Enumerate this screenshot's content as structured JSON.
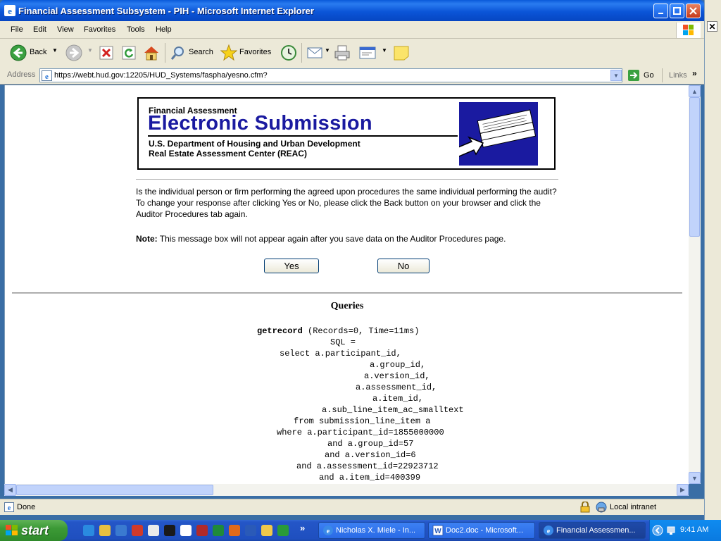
{
  "window": {
    "title": "Financial Assessment Subsystem - PIH - Microsoft Internet Explorer"
  },
  "menu": [
    "File",
    "Edit",
    "View",
    "Favorites",
    "Tools",
    "Help"
  ],
  "toolbar": {
    "back": "Back",
    "search": "Search",
    "favorites": "Favorites"
  },
  "address": {
    "label": "Address",
    "url": "https://webt.hud.gov:12205/HUD_Systems/faspha/yesno.cfm?",
    "go": "Go",
    "links": "Links"
  },
  "banner": {
    "small": "Financial  Assessment",
    "big": "Electronic Submission",
    "line1": "U.S. Department of Housing  and Urban Development",
    "line2": "Real Estate Assessment  Center (REAC)"
  },
  "page": {
    "question": "Is the individual person or firm performing the agreed upon procedures the same individual performing the audit? To change your response after clicking Yes or No, please click the Back button on your browser and click the Auditor Procedures tab again.",
    "note_label": "Note:",
    "note_text": " This message box will not appear again after you save data on the Auditor Procedures page.",
    "yes": "Yes",
    "no": "No"
  },
  "queries": {
    "heading": "Queries",
    "name": "getrecord",
    "stats": " (Records=0, Time=11ms)",
    "lines": [
      "SQL =",
      "select a.participant_id,",
      "a.group_id,",
      "a.version_id,",
      "a.assessment_id,",
      "a.item_id,",
      "a.sub_line_item_ac_smalltext",
      "from submission_line_item a",
      "where a.participant_id=1855000000",
      "and a.group_id=57",
      "and a.version_id=6",
      "and a.assessment_id=22923712",
      "and a.item_id=400399"
    ]
  },
  "status": {
    "text": "Done",
    "zone": "Local intranet"
  },
  "taskbar": {
    "start": "start",
    "tasks": [
      "Nicholas X. Miele - In...",
      "Doc2.doc - Microsoft...",
      "Financial Assessmen..."
    ],
    "clock": "9:41 AM"
  }
}
